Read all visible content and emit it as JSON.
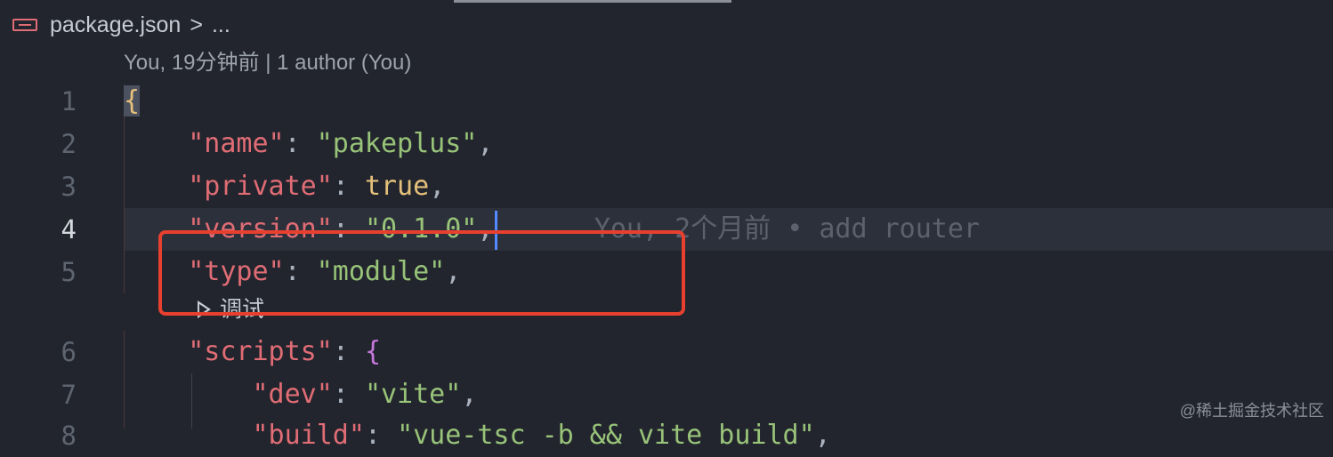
{
  "breadcrumb": {
    "file": "package.json",
    "separator": ">",
    "ellipsis": "..."
  },
  "codelens": {
    "author_info": "You, 19分钟前 | 1 author (You)"
  },
  "debug_lens": {
    "label": "调试"
  },
  "lines": [
    {
      "number": "1",
      "brace": "{"
    },
    {
      "number": "2",
      "key": "\"name\"",
      "colon": ": ",
      "value": "\"pakeplus\"",
      "comma": ","
    },
    {
      "number": "3",
      "key": "\"private\"",
      "colon": ": ",
      "value": "true",
      "comma": ","
    },
    {
      "number": "4",
      "key": "\"version\"",
      "colon": ": ",
      "value": "\"0.1.0\"",
      "comma": ",",
      "blame": "You, 2个月前 • add router"
    },
    {
      "number": "5",
      "key": "\"type\"",
      "colon": ": ",
      "value": "\"module\"",
      "comma": ","
    },
    {
      "number": "6",
      "key": "\"scripts\"",
      "colon": ": ",
      "value": "{"
    },
    {
      "number": "7",
      "key": "\"dev\"",
      "colon": ": ",
      "value": "\"vite\"",
      "comma": ","
    },
    {
      "number": "8",
      "key": "\"build\"",
      "colon": ": ",
      "value": "\"vue-tsc -b && vite build\"",
      "comma": ","
    }
  ],
  "watermark": "@稀土掘金技术社区",
  "colors": {
    "key": "#e06c75",
    "string": "#98c379",
    "boolean": "#e5c07b",
    "bracket": "#c678dd",
    "annotation_box": "#e8402f",
    "cursor": "#528bff"
  }
}
